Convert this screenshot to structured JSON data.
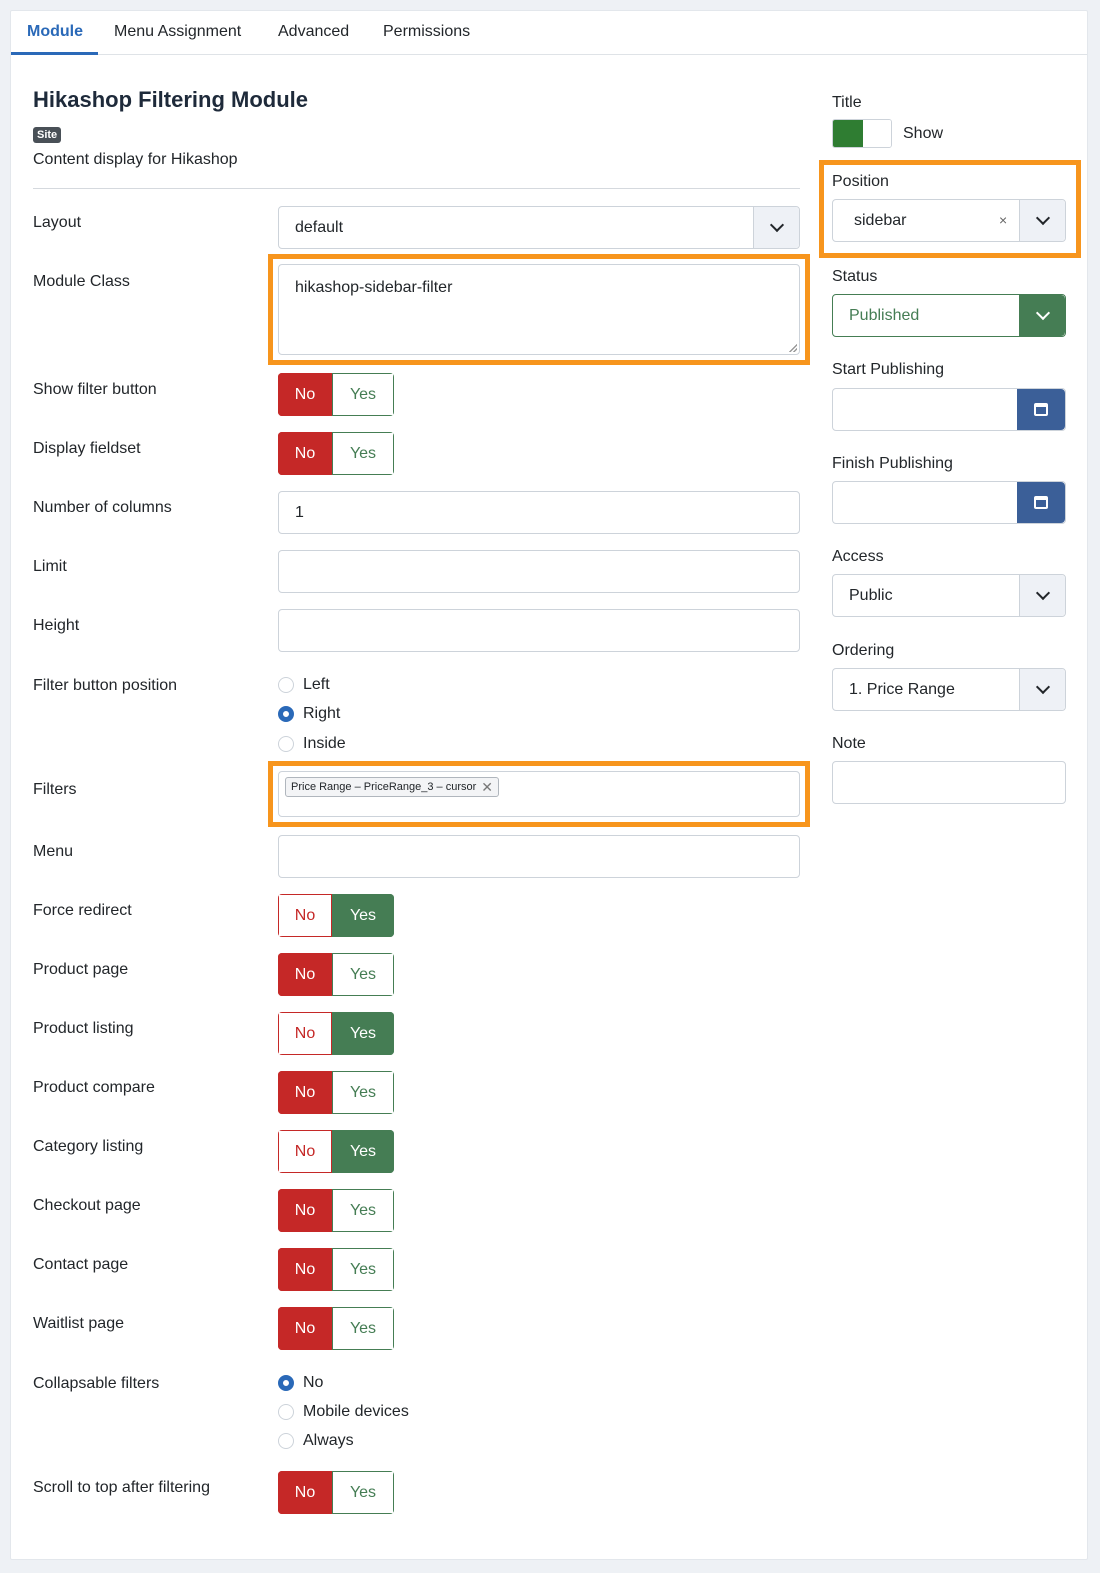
{
  "tabs": [
    {
      "label": "Module"
    },
    {
      "label": "Menu Assignment"
    },
    {
      "label": "Advanced"
    },
    {
      "label": "Permissions"
    }
  ],
  "module": {
    "title": "Hikashop Filtering Module",
    "badge": "Site",
    "description": "Content display for Hikashop"
  },
  "fields": {
    "layout": {
      "label": "Layout",
      "value": "default"
    },
    "module_class": {
      "label": "Module Class",
      "value": "hikashop-sidebar-filter"
    },
    "show_filter_button": {
      "label": "Show filter button",
      "no": "No",
      "yes": "Yes",
      "selected": "No"
    },
    "display_fieldset": {
      "label": "Display fieldset",
      "no": "No",
      "yes": "Yes",
      "selected": "No"
    },
    "columns": {
      "label": "Number of columns",
      "value": "1"
    },
    "limit": {
      "label": "Limit",
      "value": ""
    },
    "height": {
      "label": "Height",
      "value": ""
    },
    "filter_button_position": {
      "label": "Filter button position",
      "options": [
        "Left",
        "Right",
        "Inside"
      ],
      "selected": "Right"
    },
    "filters": {
      "label": "Filters",
      "chip": "Price Range – PriceRange_3 – cursor"
    },
    "menu": {
      "label": "Menu",
      "value": ""
    },
    "force_redirect": {
      "label": "Force redirect",
      "no": "No",
      "yes": "Yes",
      "selected": "Yes"
    },
    "product_page": {
      "label": "Product page",
      "no": "No",
      "yes": "Yes",
      "selected": "No"
    },
    "product_listing": {
      "label": "Product listing",
      "no": "No",
      "yes": "Yes",
      "selected": "Yes"
    },
    "product_compare": {
      "label": "Product compare",
      "no": "No",
      "yes": "Yes",
      "selected": "No"
    },
    "category_listing": {
      "label": "Category listing",
      "no": "No",
      "yes": "Yes",
      "selected": "Yes"
    },
    "checkout_page": {
      "label": "Checkout page",
      "no": "No",
      "yes": "Yes",
      "selected": "No"
    },
    "contact_page": {
      "label": "Contact page",
      "no": "No",
      "yes": "Yes",
      "selected": "No"
    },
    "waitlist_page": {
      "label": "Waitlist page",
      "no": "No",
      "yes": "Yes",
      "selected": "No"
    },
    "collapsable_filters": {
      "label": "Collapsable filters",
      "options": [
        "No",
        "Mobile devices",
        "Always"
      ],
      "selected": "No"
    },
    "scroll_to_top": {
      "label": "Scroll to top after filtering",
      "no": "No",
      "yes": "Yes",
      "selected": "No"
    }
  },
  "sidebar": {
    "title": {
      "label": "Title",
      "toggle_label": "Show",
      "enabled": true
    },
    "position": {
      "label": "Position",
      "value": "sidebar",
      "clear": "×"
    },
    "status": {
      "label": "Status",
      "value": "Published"
    },
    "start_publishing": {
      "label": "Start Publishing",
      "value": ""
    },
    "finish_publishing": {
      "label": "Finish Publishing",
      "value": ""
    },
    "access": {
      "label": "Access",
      "value": "Public"
    },
    "ordering": {
      "label": "Ordering",
      "value": "1. Price Range"
    },
    "note": {
      "label": "Note",
      "value": ""
    }
  },
  "colors": {
    "accent": "#2a69b8",
    "no_active": "#c52827",
    "yes_active": "#457d54",
    "highlight": "#f7951d",
    "calendar_button": "#3b5f98"
  },
  "icons": {
    "select": "chevron-down-icon",
    "calendar": "calendar-icon",
    "clear": "close-icon"
  }
}
